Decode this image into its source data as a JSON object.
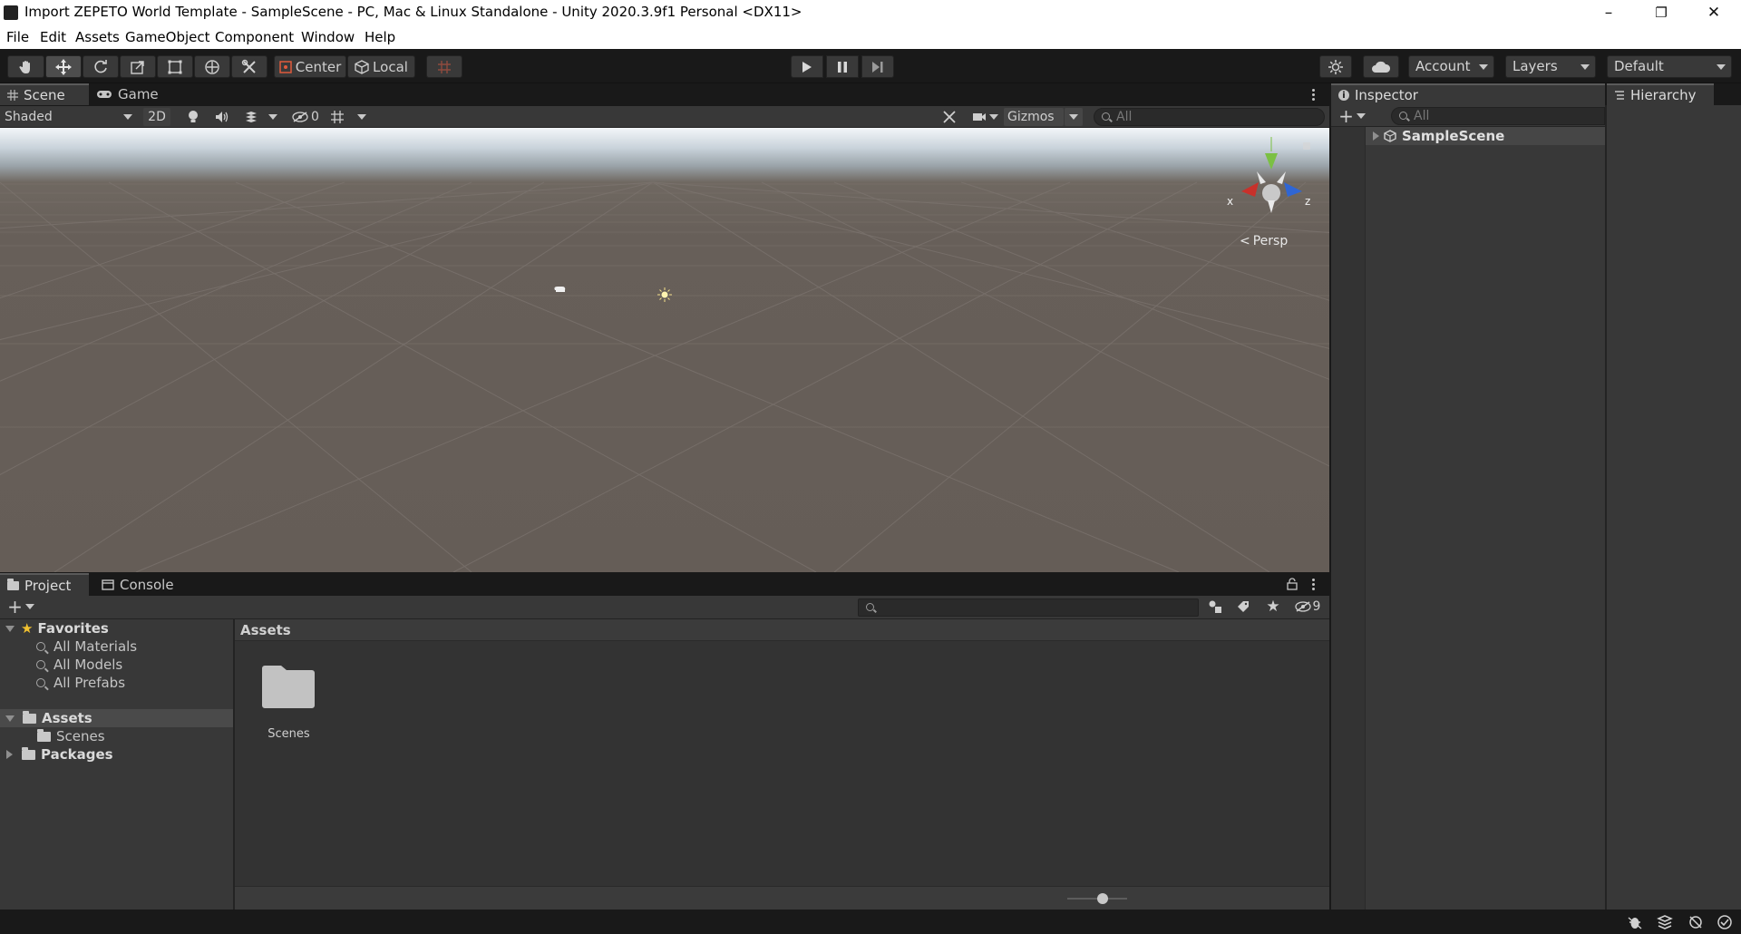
{
  "window": {
    "title": "Import ZEPETO World Template - SampleScene - PC, Mac & Linux Standalone - Unity 2020.3.9f1 Personal <DX11>",
    "controls": {
      "minimize": "–",
      "restore": "❐",
      "close": "✕"
    }
  },
  "menu": [
    "File",
    "Edit",
    "Assets",
    "GameObject",
    "Component",
    "Window",
    "Help"
  ],
  "toolbar": {
    "tools": [
      "hand-tool",
      "move-tool",
      "rotate-tool",
      "scale-tool",
      "rect-tool",
      "transform-tool",
      "custom-tool"
    ],
    "pivot_mode": "Center",
    "pivot_rotation": "Local",
    "account_label": "Account",
    "layers_label": "Layers",
    "layout_label": "Default"
  },
  "scene_panel": {
    "tabs": [
      "Scene",
      "Game"
    ],
    "shading_mode": "Shaded",
    "mode_2d": "2D",
    "hidden_count": "0",
    "gizmos_label": "Gizmos",
    "search_placeholder": "All",
    "projection_label": "Persp",
    "axis_x": "x",
    "axis_z": "z"
  },
  "inspector": {
    "tab": "Inspector",
    "search_placeholder": "All",
    "scene_item": "SampleScene"
  },
  "hierarchy": {
    "tab": "Hierarchy"
  },
  "project_panel": {
    "tabs": [
      "Project",
      "Console"
    ],
    "hidden_packages_count": "9",
    "breadcrumb": "Assets",
    "tree": {
      "favorites_label": "Favorites",
      "favorites": [
        "All Materials",
        "All Models",
        "All Prefabs"
      ],
      "assets_label": "Assets",
      "assets_children": [
        "Scenes"
      ],
      "packages_label": "Packages"
    },
    "asset_items": [
      "Scenes"
    ]
  },
  "colors": {
    "editor_dark": "#191919",
    "panel": "#383838",
    "axis_x": "#c8312b",
    "axis_y": "#7bc043",
    "axis_z": "#2f66d4"
  }
}
